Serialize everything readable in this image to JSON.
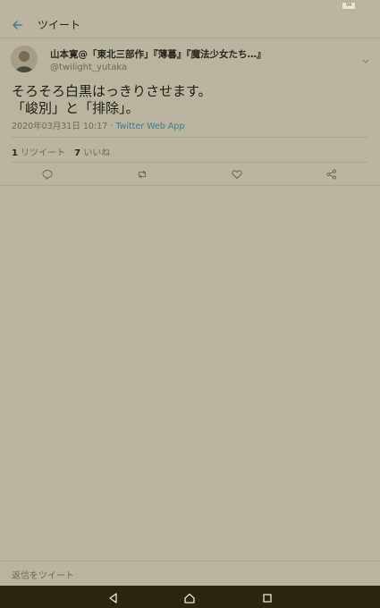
{
  "status_bar": {
    "battery": "94"
  },
  "header": {
    "title": "ツイート"
  },
  "tweet": {
    "display_name": "山本寛@「東北三部作」『薄暮』『魔法少女たち…』",
    "handle": "@twilight_yutaka",
    "text": "そろそろ白黒はっきりさせます。\n「峻別」と「排除」。",
    "timestamp": "2020年03月31日 10:17 · ",
    "source": "Twitter Web App",
    "retweet_count": "1",
    "retweet_label": "リツイート",
    "like_count": "7",
    "like_label": "いいね"
  },
  "reply": {
    "placeholder": "返信をツイート"
  },
  "icons": {
    "back": "back-arrow-icon",
    "caret": "chevron-down-icon",
    "reply": "reply-icon",
    "retweet": "retweet-icon",
    "like": "heart-icon",
    "share": "share-icon"
  },
  "colors": {
    "background": "#b9b49d",
    "link": "#3a7f9b",
    "nav_bar": "#2a2611"
  }
}
